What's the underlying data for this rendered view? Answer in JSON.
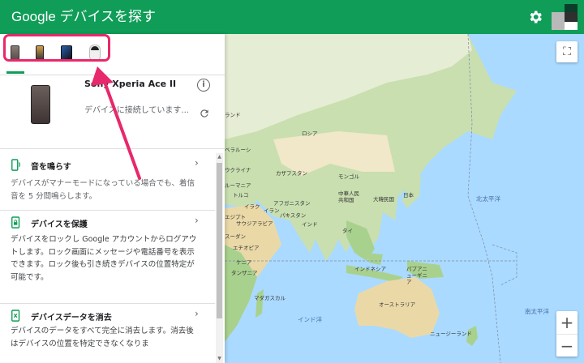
{
  "header": {
    "title_brand": "Google",
    "title_app": "デバイスを探す",
    "bg_color": "#0f9d58"
  },
  "devices": {
    "tabs": [
      "phone-1",
      "phone-2",
      "phone-3",
      "speaker"
    ],
    "selected": {
      "name": "Sony Xperia Ace II",
      "status": "デバイスに接続しています..."
    }
  },
  "actions": [
    {
      "icon": "ring-phone-icon",
      "title": "音を鳴らす",
      "desc": "デバイスがマナーモードになっている場合でも、着信音を 5 分間鳴らします。"
    },
    {
      "icon": "lock-phone-icon",
      "title": "デバイスを保護",
      "desc": "デバイスをロックし Google アカウントからログアウトします。ロック画面にメッセージや電話番号を表示できます。ロック後も引き続きデバイスの位置特定が可能です。"
    },
    {
      "icon": "erase-phone-icon",
      "title": "デバイスデータを消去",
      "desc": "デバイスのデータをすべて完全に消去します。消去後はデバイスの位置を特定できなくなりま"
    }
  ],
  "map": {
    "labels": [
      {
        "text": "ランド"
      },
      {
        "text": "ロシア"
      },
      {
        "text": "ベラルーシ"
      },
      {
        "text": "ウクライナ"
      },
      {
        "text": "カザフスタン"
      },
      {
        "text": "モンゴル"
      },
      {
        "text": "ルーマニア"
      },
      {
        "text": "トルコ"
      },
      {
        "text": "イラク"
      },
      {
        "text": "イラン"
      },
      {
        "text": "アフガニスタン"
      },
      {
        "text": "パキスタン"
      },
      {
        "text": "中華人民共和国"
      },
      {
        "text": "大韓民国"
      },
      {
        "text": "日本"
      },
      {
        "text": "エジプト"
      },
      {
        "text": "サウジアラビア"
      },
      {
        "text": "インド"
      },
      {
        "text": "タイ"
      },
      {
        "text": "スーダン"
      },
      {
        "text": "エチオピア"
      },
      {
        "text": "ケニア"
      },
      {
        "text": "タンザニア"
      },
      {
        "text": "インドネシア"
      },
      {
        "text": "パプアニューギニア"
      },
      {
        "text": "マダガスカル"
      },
      {
        "text": "オーストラリア"
      },
      {
        "text": "ニュージーランド"
      }
    ],
    "oceans": [
      "北太平洋",
      "インド洋",
      "南太平洋"
    ],
    "zoom_in": "+",
    "zoom_out": "−",
    "fullscreen": "⛶"
  }
}
